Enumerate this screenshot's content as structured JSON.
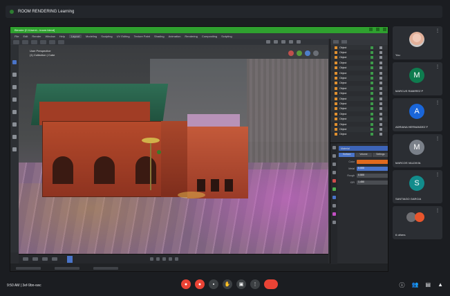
{
  "meeting": {
    "title": "ROOM RENDERING Learning",
    "time_label": "9:50 AM | 3ef-9bn-vwc"
  },
  "blender": {
    "window_title": "Blender [C:\\Users\\...\\room.blend]",
    "menu": [
      "File",
      "Edit",
      "Render",
      "Window",
      "Help",
      "Layout",
      "Modeling",
      "Sculpting",
      "UV Editing",
      "Texture Paint",
      "Shading",
      "Animation",
      "Rendering",
      "Compositing",
      "Scripting"
    ],
    "active_workspace": "Layout",
    "viewport_info": [
      "User Perspective",
      "(1) Collection | Cube"
    ],
    "outliner_items": [
      "Object",
      "Object",
      "Object",
      "Object",
      "Object",
      "Object",
      "Object",
      "Object",
      "Object",
      "Object",
      "Object",
      "Object",
      "Object",
      "Object",
      "Object",
      "Object",
      "Object",
      "Object"
    ],
    "properties": {
      "search_value": "Material",
      "fields": [
        {
          "label": "Color",
          "value": "",
          "style": "orange"
        },
        {
          "label": "Metal",
          "value": "0.000",
          "style": "blue"
        },
        {
          "label": "Rough",
          "value": "0.500",
          "style": "plain"
        },
        {
          "label": "IOR",
          "value": "1.450",
          "style": "plain"
        }
      ],
      "tabs": [
        "Surface",
        "Volume",
        "Settings"
      ]
    }
  },
  "participants": [
    {
      "name": "You",
      "initial": "",
      "color": "#c9c9c9",
      "type": "photo"
    },
    {
      "name": "MARCUS RAMIREZ P",
      "initial": "M",
      "color": "#0f7c4f",
      "type": "letter"
    },
    {
      "name": "ADRIANA HERNANDEZ F",
      "initial": "A",
      "color": "#1a66d9",
      "type": "letter"
    },
    {
      "name": "MARCOS VALDIVIA",
      "initial": "M",
      "color": "#7a8089",
      "type": "letter"
    },
    {
      "name": "SANTIAGO GARCIA",
      "initial": "S",
      "color": "#128c8c",
      "type": "letter"
    },
    {
      "name": "6 others",
      "initial": "",
      "color": "#6f6f73",
      "type": "stack"
    }
  ],
  "colors": {
    "accent": "#2fa12f",
    "end_call": "#ea4335",
    "selection": "#e06a1e",
    "blender_blue": "#4a74c9"
  }
}
